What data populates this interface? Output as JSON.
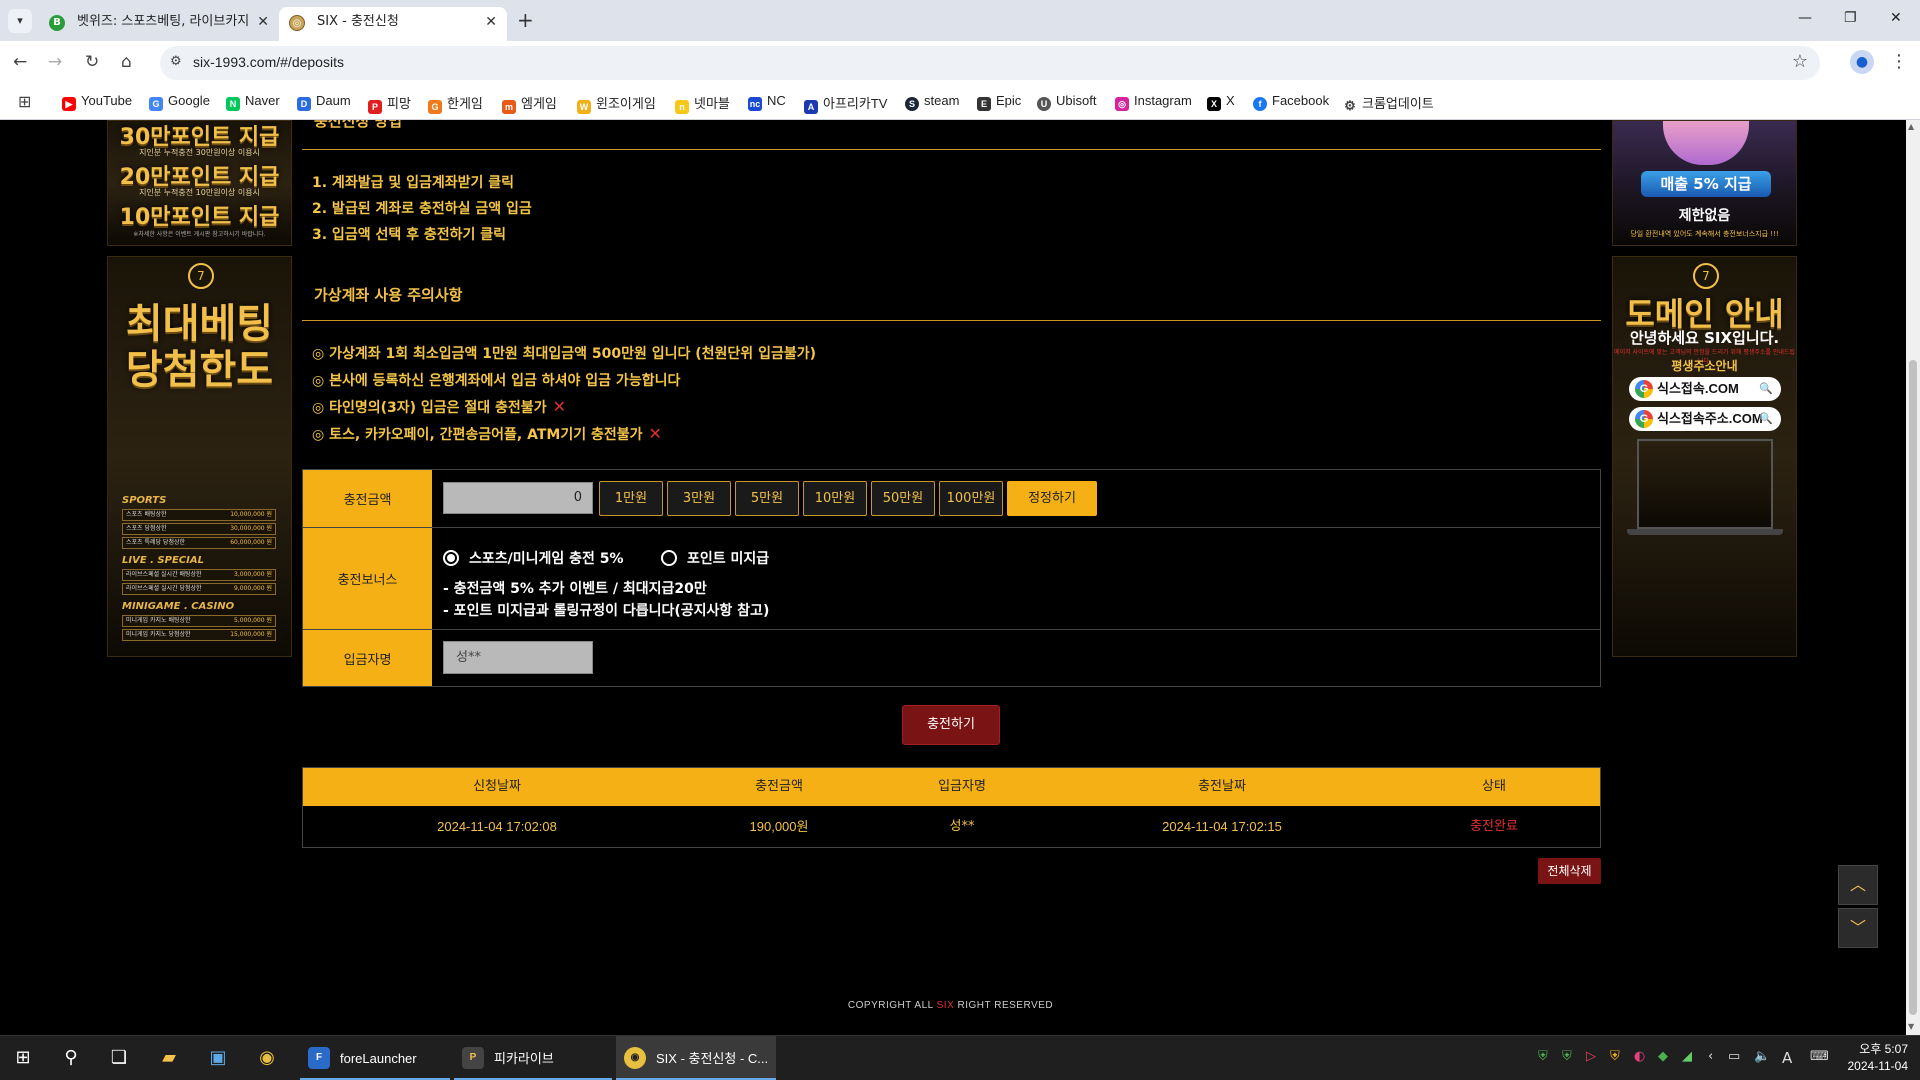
{
  "browser": {
    "tabs": [
      {
        "title": "벳위즈: 스포츠베팅, 라이브카지",
        "favicon": "B"
      },
      {
        "title": "SIX - 충전신청",
        "favicon": "◎"
      }
    ],
    "new_tab": "+",
    "url": "six-1993.com/#/deposits",
    "bookmarks": [
      "YouTube",
      "Google",
      "Naver",
      "Daum",
      "피망",
      "한게임",
      "엠게임",
      "윈조이게임",
      "넷마블",
      "NC",
      "아프리카TV",
      "steam",
      "Epic",
      "Ubisoft",
      "Instagram",
      "X",
      "Facebook",
      "크롬업데이트"
    ]
  },
  "left_banner_1": {
    "line1": "30만포인트 지급",
    "sub1": "지인분 누적충전 30만원이상 이용시",
    "line2": "20만포인트 지급",
    "sub2": "지인분 누적충전 10만원이상 이용시",
    "line3": "10만포인트 지급",
    "footnote": "※자세한 사항은 이벤트 게시판 참고하시기 바랍니다."
  },
  "left_banner_2": {
    "title1": "최대베팅",
    "title2": "당첨한도",
    "sections": [
      {
        "name": "SPORTS",
        "rows": [
          {
            "label": "스포츠 배팅상한",
            "value": "10,000,000 원"
          },
          {
            "label": "스포츠 당첨상한",
            "value": "30,000,000 원"
          },
          {
            "label": "스포츠 특례당 당첨상한",
            "value": "60,000,000 원"
          }
        ]
      },
      {
        "name": "LIVE . SPECIAL",
        "rows": [
          {
            "label": "라이브스페셜 실시간 배팅상한",
            "value": "3,000,000 원"
          },
          {
            "label": "라이브스페셜 실시간 당첨상한",
            "value": "9,000,000 원"
          }
        ]
      },
      {
        "name": "MINIGAME . CASINO",
        "rows": [
          {
            "label": "미니게임 카지노 배팅상한",
            "value": "5,000,000 원"
          },
          {
            "label": "미니게임 카지노 당첨상한",
            "value": "15,000,000 원"
          }
        ]
      }
    ]
  },
  "right_banner_1": {
    "badge": "매출 5% 지급",
    "sub": "제한없음",
    "footnote": "당일 환전내역 있어도 계속해서 충전보너스지급 !!!"
  },
  "right_banner_2": {
    "title": "도메인 안내",
    "greeting": "안녕하세요 SIX입니다.",
    "small": "메이저 사이트에 맞는 고객님의 안정을 드리기 위해 평생주소를 안내드립니다.",
    "permanent": "평생주소안내",
    "domains": [
      "식스접속.COM",
      "식스접속주소.COM"
    ]
  },
  "how_to": {
    "title": "충전신청 방법",
    "steps": [
      "1. 계좌발급 및 입금계좌받기 클릭",
      "2. 발급된 계좌로 충전하실 금액 입금",
      "3. 입금액 선택 후 충전하기 클릭"
    ]
  },
  "caution": {
    "title": "가상계좌 사용 주의사항",
    "items": [
      {
        "text": "◎ 가상계좌 1회 최소입금액 1만원 최대입금액 500만원 입니다 (천원단위 입금불가)",
        "x": ""
      },
      {
        "text": "◎ 본사에 등록하신 은행계좌에서 입금 하셔야 입금 가능합니다",
        "x": ""
      },
      {
        "text": "◎ 타인명의(3자) 입금은 절대 충전불가",
        "x": "✕"
      },
      {
        "text": "◎ 토스, 카카오페이, 간편송금어플, ATM기기 충전불가",
        "x": "✕"
      }
    ]
  },
  "form": {
    "amount_label": "충전금액",
    "amount_value": "0",
    "amount_buttons": [
      "1만원",
      "3만원",
      "5만원",
      "10만원",
      "50만원",
      "100만원"
    ],
    "reset_label": "정정하기",
    "bonus_label": "충전보너스",
    "bonus_options": [
      {
        "label": "스포츠/미니게임 충전 5%",
        "selected": true
      },
      {
        "label": "포인트 미지급",
        "selected": false
      }
    ],
    "bonus_notes": [
      "- 충전금액 5% 추가 이벤트 / 최대지급20만",
      "- 포인트 미지급과 롤링규정이 다릅니다(공지사항 참고)"
    ],
    "name_label": "입금자명",
    "name_value": "성**",
    "submit_label": "충전하기"
  },
  "history": {
    "headers": [
      "신청날짜",
      "충전금액",
      "입금자명",
      "충전날짜",
      "상태"
    ],
    "rows": [
      [
        "2024-11-04 17:02:08",
        "190,000원",
        "성**",
        "2024-11-04 17:02:15",
        "충전완료"
      ]
    ],
    "delete_all": "전체삭제"
  },
  "footer": {
    "prefix": "COPYRIGHT ALL ",
    "brand": "SIX",
    "suffix": " RIGHT RESERVED"
  },
  "scroll_buttons": {
    "up": "︿",
    "down": "﹀"
  },
  "taskbar": {
    "apps": [
      "foreLauncher",
      "피카라이브",
      "SIX - 충전신청 - C..."
    ],
    "time": "오후 5:07",
    "date": "2024-11-04",
    "ime": "A"
  },
  "colors": {
    "gold": "#f5b015",
    "gold_text": "#f2c04a",
    "danger": "#e03030",
    "dark_red": "#7a1414"
  }
}
